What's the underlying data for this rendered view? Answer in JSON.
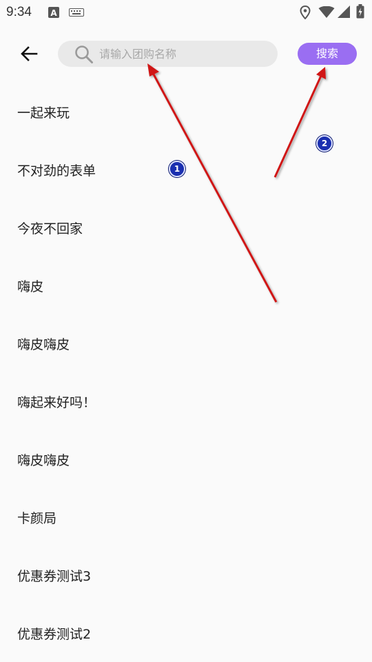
{
  "status_bar": {
    "time": "9:34",
    "icons": [
      "keyboard-a-icon",
      "keyboard-icon",
      "location-icon",
      "wifi-icon",
      "signal-icon",
      "battery-icon"
    ]
  },
  "header": {
    "back_icon": "arrow-left-icon",
    "search": {
      "placeholder": "请输入团购名称",
      "value": "",
      "icon": "search-icon"
    },
    "search_button_label": "搜索",
    "accent_color": "#9a6ef2"
  },
  "list": {
    "items": [
      "一起来玩",
      "不对劲的表单",
      "今夜不回家",
      "嗨皮",
      "嗨皮嗨皮",
      "嗨起来好吗！",
      "嗨皮嗨皮",
      "卡颜局",
      "优惠券测试3",
      "优惠券测试2"
    ]
  },
  "annotations": {
    "markers": [
      "1",
      "2"
    ],
    "arrow_color": "#d01818"
  }
}
